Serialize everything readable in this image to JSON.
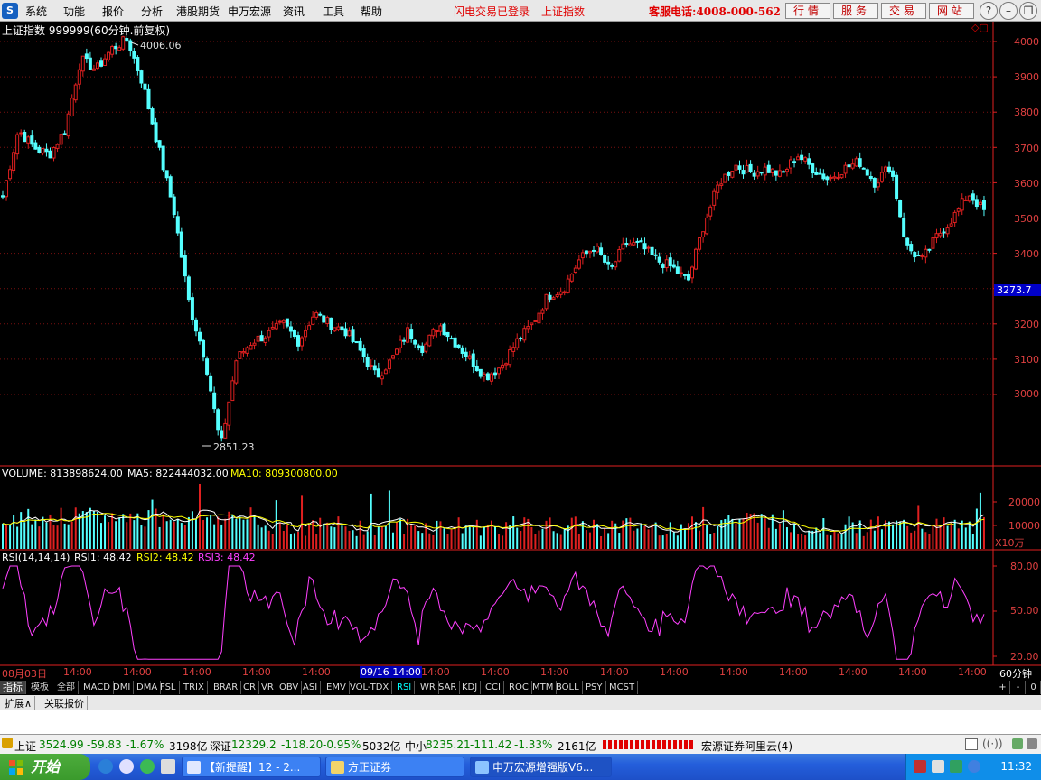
{
  "menu": {
    "items": [
      "系统",
      "功能",
      "报价",
      "分析",
      "港股期货",
      "申万宏源",
      "资讯",
      "工具",
      "帮助"
    ],
    "status": "闪电交易已登录",
    "index_name": "上证指数",
    "hotline": "客服电话:4008-000-562",
    "tabs": [
      "行情",
      "服务",
      "交易",
      "网站"
    ]
  },
  "chart": {
    "title": "上证指数 999999(60分钟.前复权)",
    "high_label": "4006.06",
    "low_label": "2851.23",
    "price_ticks": [
      "4000",
      "3900",
      "3800",
      "3700",
      "3600",
      "3500",
      "3400",
      "3200",
      "3100",
      "3000"
    ],
    "current_price": "3273.7",
    "volume": {
      "name": "VOLUME: 813898624.00",
      "ma5": "MA5: 822444032.00",
      "ma10": "MA10: 809300800.00",
      "ticks": [
        "20000",
        "10000"
      ],
      "unit": "X10万"
    },
    "rsi": {
      "name": "RSI(14,14,14)",
      "rsi1": "RSI1: 48.42",
      "rsi2": "RSI2: 48.42",
      "rsi3": "RSI3: 48.42",
      "ticks": [
        "80.00",
        "50.00",
        "20.00"
      ]
    },
    "time_axis": {
      "first": "08月03日",
      "repeated": "14:00",
      "cursor": "09/16 14:00",
      "period": "60分钟"
    }
  },
  "chart_data": {
    "type": "line",
    "title": "上证指数 999999(60分钟.前复权)",
    "xlabel": "",
    "ylabel": "",
    "ylim": [
      2851.23,
      4006.06
    ],
    "series": [
      {
        "name": "",
        "values": [
          3560,
          3750,
          3700,
          3680,
          3750,
          3950,
          3920,
          3980,
          4006,
          3880,
          3700,
          3520,
          3250,
          3100,
          2851,
          3100,
          3150,
          3170,
          3200,
          3150,
          3230,
          3200,
          3180,
          3120,
          3050,
          3100,
          3180,
          3130,
          3200,
          3150,
          3100,
          3050,
          3080,
          3150,
          3200,
          3280,
          3300,
          3380,
          3420,
          3350,
          3430,
          3420,
          3380,
          3360,
          3320,
          3480,
          3600,
          3650,
          3630,
          3640,
          3620,
          3680,
          3640,
          3610,
          3640,
          3660,
          3600,
          3650,
          3420,
          3380,
          3450,
          3500,
          3570,
          3520
        ]
      }
    ]
  },
  "indicators": {
    "lead": "指标",
    "items": [
      "模板",
      "全部",
      "MACD",
      "DMI",
      "DMA",
      "FSL",
      "TRIX",
      "BRAR",
      "CR",
      "VR",
      "OBV",
      "ASI",
      "EMV",
      "VOL-TDX",
      "RSI",
      "WR",
      "SAR",
      "KDJ",
      "CCI",
      "ROC",
      "MTM",
      "BOLL",
      "PSY",
      "MCST"
    ],
    "active": "RSI",
    "right": [
      "+",
      "-",
      "0"
    ]
  },
  "ext": [
    "扩展∧",
    "关联报价"
  ],
  "status": {
    "sh_label": "上证",
    "sh_value": "3524.99",
    "sh_change": "-59.83",
    "sh_pct": "-1.67%",
    "sh_amount": "3198亿",
    "sz_label": "深证",
    "sz_value": "12329.2",
    "sz_change": "-118.20",
    "sz_pct": "-0.95%",
    "sz_amount": "5032亿",
    "zx_label": "中小",
    "zx_value": "8235.21",
    "zx_change": "-111.42",
    "zx_pct": "-1.33%",
    "zx_amount": "2161亿",
    "broker": "宏源证券阿里云(4)"
  },
  "taskbar": {
    "start": "开始",
    "items": [
      "【新提醒】12 - 2...",
      "方正证券",
      "申万宏源增强版V6..."
    ],
    "clock": "11:32"
  }
}
